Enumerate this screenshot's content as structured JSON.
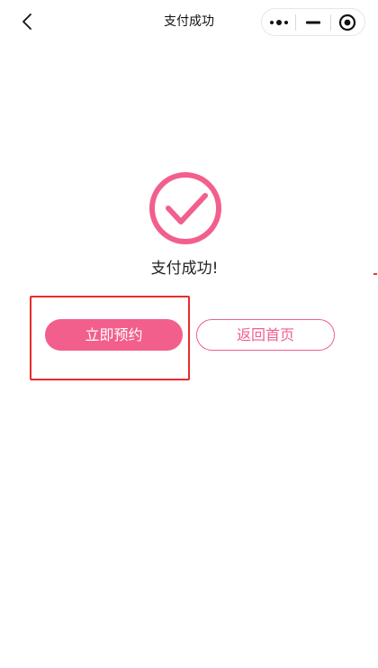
{
  "nav": {
    "title": "支付成功",
    "back_icon": "chevron-left-icon",
    "capsule": {
      "more_icon": "more-dots-icon",
      "minimize_icon": "minimize-icon",
      "close_icon": "target-close-icon"
    }
  },
  "result": {
    "icon": "check-circle-icon",
    "message": "支付成功!"
  },
  "actions": {
    "primary_label": "立即预约",
    "secondary_label": "返回首页"
  },
  "colors": {
    "accent": "#f25f8c",
    "highlight_border": "#e82b2b"
  }
}
